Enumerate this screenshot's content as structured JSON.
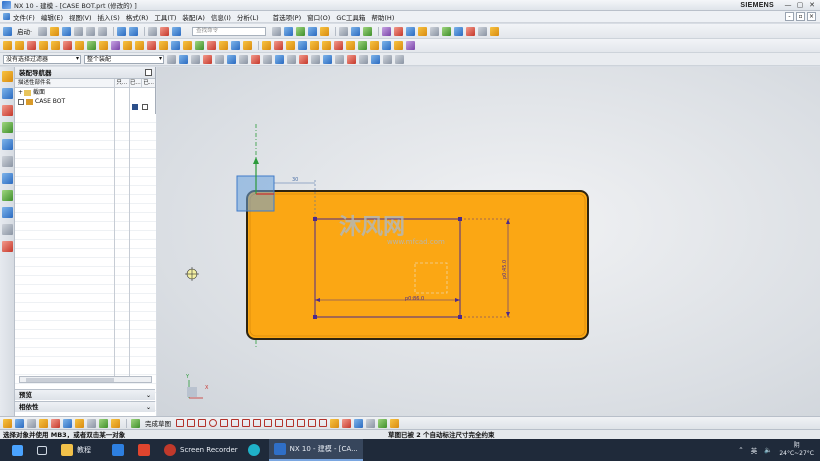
{
  "window": {
    "title": "NX 10 - 建模 - [CASE BOT.prt  (修改的)  ]",
    "brand": "SIEMENS",
    "controls": [
      "—",
      "▢",
      "✕"
    ]
  },
  "menu": {
    "items": [
      "文件(F)",
      "编辑(E)",
      "视图(V)",
      "插入(S)",
      "格式(R)",
      "工具(T)",
      "装配(A)",
      "信息(I)",
      "分析(L)",
      "首选项(P)",
      "窗口(O)",
      "GC工具箱",
      "帮助(H)"
    ]
  },
  "toolbar": {
    "start_label": "启动·",
    "search_placeholder": "查找命令",
    "filter_select": "没有选择过滤器",
    "assembly_select": "整个装配"
  },
  "navigator": {
    "title": "装配导航器",
    "columns": {
      "name": "描述性部件名",
      "c1": "只...",
      "c2": "已...",
      "c3": "已..."
    },
    "rows": [
      {
        "expander": "+",
        "label": "截面"
      },
      {
        "expander": "",
        "label": "CASE BOT"
      }
    ],
    "panels": [
      {
        "label": "预览",
        "chevron": "⌄"
      },
      {
        "label": "相依性",
        "chevron": "⌄"
      }
    ]
  },
  "canvas": {
    "watermark_cn": "沐风网",
    "watermark_url": "www.mfcad.com",
    "dim_top": "30",
    "dim_horizontal": "p0:86.0",
    "dim_vertical": "p0:45.0",
    "axis_x": "X",
    "axis_y": "Y"
  },
  "colors": {
    "part": "#fba714",
    "part_edge": "#2e2410",
    "sketch": "#4b2a8c",
    "datum": "#3f7bc9",
    "green_axis": "#2b9a3a"
  },
  "bottom_toolbar": {
    "finish_label": "完成草图"
  },
  "status": {
    "left": "选择对象并使用 MB3，或者双击某一对象",
    "right": "草图已被 2 个自动标注尺寸完全约束"
  },
  "taskbar": {
    "items": [
      {
        "label": "",
        "icon": "start-icon",
        "color": "#4aa3ff"
      },
      {
        "label": "",
        "icon": "task-view-icon",
        "color": "#cfd8e3"
      },
      {
        "label": "教程",
        "icon": "folder-icon",
        "color": "#f2c14a"
      },
      {
        "label": "",
        "icon": "app-blue-icon",
        "color": "#2d7fe0"
      },
      {
        "label": "",
        "icon": "app-red-icon",
        "color": "#e0452e"
      },
      {
        "label": "Screen Recorder",
        "icon": "screen-recorder-icon",
        "color": "#c0392b"
      },
      {
        "label": "",
        "icon": "edge-icon",
        "color": "#1fb1c8"
      },
      {
        "label": "NX 10 - 建模 - [CA...",
        "icon": "nx-icon",
        "color": "#2f6fc7"
      }
    ],
    "tray": {
      "ime": "英",
      "weather_icon": "阴",
      "temp": "24°C~27°C"
    }
  }
}
